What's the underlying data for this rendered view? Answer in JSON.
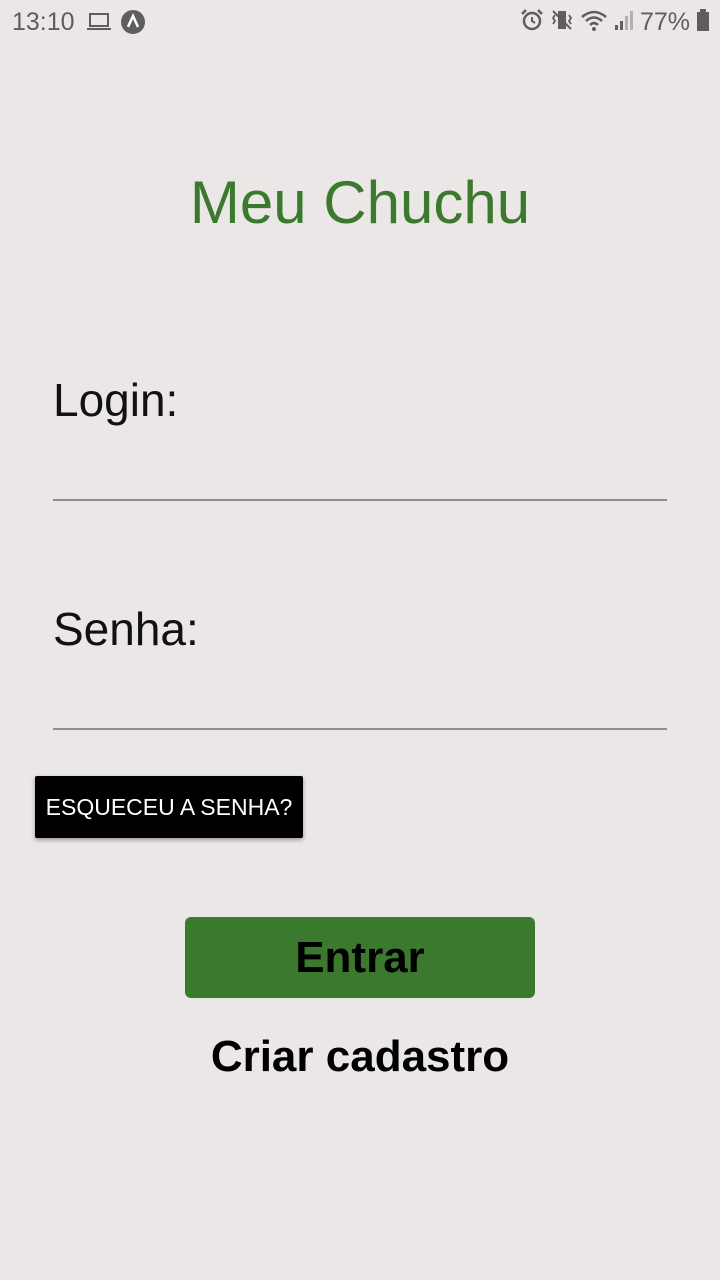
{
  "status_bar": {
    "time": "13:10",
    "battery": "77%",
    "left_icons": [
      "laptop-icon",
      "app-notification-icon"
    ],
    "right_icons": [
      "alarm-icon",
      "vibrate-icon",
      "wifi-icon",
      "signal-icon",
      "battery-icon"
    ]
  },
  "app": {
    "title": "Meu Chuchu"
  },
  "form": {
    "login_label": "Login:",
    "login_value": "",
    "password_label": "Senha:",
    "password_value": "",
    "forgot_password": "ESQUECEU A SENHA?",
    "submit": "Entrar",
    "register": "Criar cadastro"
  },
  "colors": {
    "background": "#ece7e7",
    "accent": "#3b7a2e",
    "input_underline": "#8b8f98"
  }
}
